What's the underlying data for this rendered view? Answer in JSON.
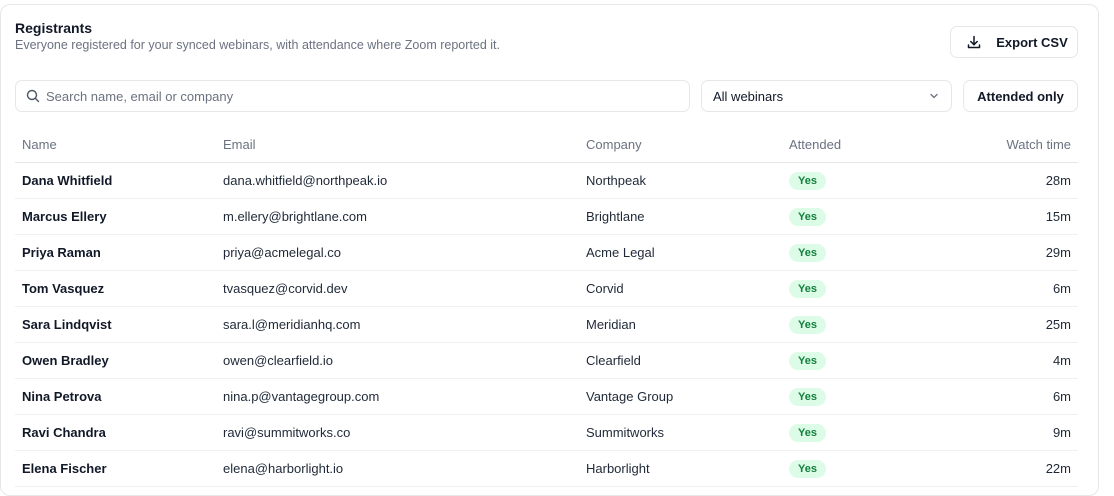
{
  "header": {
    "title": "Registrants",
    "subtitle": "Everyone registered for your synced webinars, with attendance where Zoom reported it."
  },
  "toolbar": {
    "export_label": "Export CSV",
    "export_icon": "download-icon",
    "search_placeholder": "Search name, email or company",
    "search_value": "",
    "webinar_filter": "All webinars",
    "attended_only_label": "Attended only"
  },
  "table": {
    "columns": [
      "Name",
      "Email",
      "Company",
      "Attended",
      "Watch time"
    ],
    "rows": [
      {
        "name": "Dana Whitfield",
        "email": "dana.whitfield@northpeak.io",
        "company": "Northpeak",
        "attended": "Yes",
        "watch_time": "28m"
      },
      {
        "name": "Marcus Ellery",
        "email": "m.ellery@brightlane.com",
        "company": "Brightlane",
        "attended": "Yes",
        "watch_time": "15m"
      },
      {
        "name": "Priya Raman",
        "email": "priya@acmelegal.co",
        "company": "Acme Legal",
        "attended": "Yes",
        "watch_time": "29m"
      },
      {
        "name": "Tom Vasquez",
        "email": "tvasquez@corvid.dev",
        "company": "Corvid",
        "attended": "Yes",
        "watch_time": "6m"
      },
      {
        "name": "Sara Lindqvist",
        "email": "sara.l@meridianhq.com",
        "company": "Meridian",
        "attended": "Yes",
        "watch_time": "25m"
      },
      {
        "name": "Owen Bradley",
        "email": "owen@clearfield.io",
        "company": "Clearfield",
        "attended": "Yes",
        "watch_time": "4m"
      },
      {
        "name": "Nina Petrova",
        "email": "nina.p@vantagegroup.com",
        "company": "Vantage Group",
        "attended": "Yes",
        "watch_time": "6m"
      },
      {
        "name": "Ravi Chandra",
        "email": "ravi@summitworks.co",
        "company": "Summitworks",
        "attended": "Yes",
        "watch_time": "9m"
      },
      {
        "name": "Elena Fischer",
        "email": "elena@harborlight.io",
        "company": "Harborlight",
        "attended": "Yes",
        "watch_time": "22m"
      }
    ]
  },
  "colors": {
    "badge_bg": "#dcfce7",
    "badge_text": "#15803d",
    "border": "#e5e7eb",
    "muted_text": "#6b7280"
  }
}
